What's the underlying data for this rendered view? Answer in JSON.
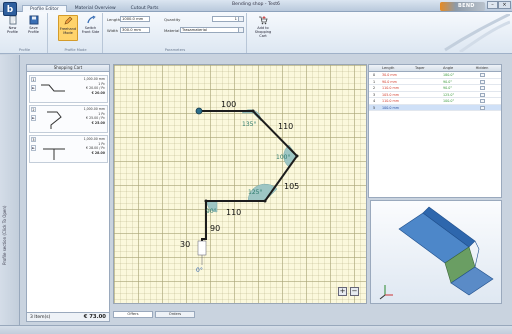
{
  "window": {
    "title": "Bending shop - Test6",
    "brand_name": "BEND",
    "min": "–",
    "max": "▫",
    "close": "×"
  },
  "app_icon": "b",
  "tabs": [
    {
      "label": "Profile Editor",
      "active": true
    },
    {
      "label": "Material Overview",
      "active": false
    },
    {
      "label": "Cutout Parts",
      "active": false
    }
  ],
  "ribbon": {
    "groups": {
      "profile": "Profile",
      "profile_mode": "Profile Mode",
      "parameters": "Parameters",
      "cart": ""
    },
    "new_profile": "New Profile",
    "save_profile": "Save Profile",
    "freehand_mode": "Freehand Mode",
    "switch_front_side": "Switch Front Side",
    "length_label": "Length",
    "length_value": "1000.0 mm",
    "width_label": "Width",
    "width_value": "300.0 mm",
    "quantity_label": "Quantity",
    "quantity_value": "1",
    "material_label": "Material",
    "material_value": "Trasamaterial",
    "add_to_cart": "Add to Shopping Cart"
  },
  "sidebar": {
    "label": "Profile section (Click To Open)"
  },
  "cart": {
    "title": "Shopping Cart",
    "items": [
      {
        "index": "1",
        "length": "1,000.00 mm",
        "quantity": "1 Pc",
        "unit_price": "€ 20.00 / Pc",
        "price": "€ 20.00"
      },
      {
        "index": "2",
        "length": "1,000.00 mm",
        "quantity": "1 Pc",
        "unit_price": "€ 25.00 / Pc",
        "price": "€ 25.00"
      },
      {
        "index": "3",
        "length": "1,000.00 mm",
        "quantity": "1 Pc",
        "unit_price": "€ 28.00 / Pc",
        "price": "€ 28.00"
      }
    ],
    "item_count": "3 Item(s)",
    "total": "€ 73.00"
  },
  "canvas": {
    "lengths": [
      "100",
      "110",
      "105",
      "110",
      "90",
      "30"
    ],
    "angles": [
      "135°",
      "100°",
      "125°",
      "90°",
      "0°"
    ],
    "zoom_in": "+",
    "zoom_out": "−"
  },
  "table": {
    "headers": [
      "",
      "Length",
      "Taper",
      "Angle",
      "Hidden"
    ],
    "rows": [
      {
        "index": "0",
        "length": "30.0 mm",
        "length_color": "red",
        "taper": "",
        "angle": "180.0°",
        "angle_color": "green"
      },
      {
        "index": "1",
        "length": "90.0 mm",
        "length_color": "red",
        "taper": "",
        "angle": "90.0°",
        "angle_color": "green"
      },
      {
        "index": "2",
        "length": "110.0 mm",
        "length_color": "red",
        "taper": "",
        "angle": "90.0°",
        "angle_color": "green"
      },
      {
        "index": "3",
        "length": "105.0 mm",
        "length_color": "red",
        "taper": "",
        "angle": "125.0°",
        "angle_color": "green"
      },
      {
        "index": "4",
        "length": "110.0 mm",
        "length_color": "red",
        "taper": "",
        "angle": "100.0°",
        "angle_color": "green"
      },
      {
        "index": "5",
        "length": "100.0 mm",
        "length_color": "blue",
        "taper": "",
        "angle": "",
        "angle_color": "green"
      }
    ]
  },
  "bottom_tabs": [
    "Offers",
    "Orders"
  ],
  "colors": {
    "accent": "#2f5f9e",
    "canvas_bg": "#fbf8dc",
    "profile_line": "#1c1c1c",
    "angle_fill": "#9ec6c4"
  }
}
